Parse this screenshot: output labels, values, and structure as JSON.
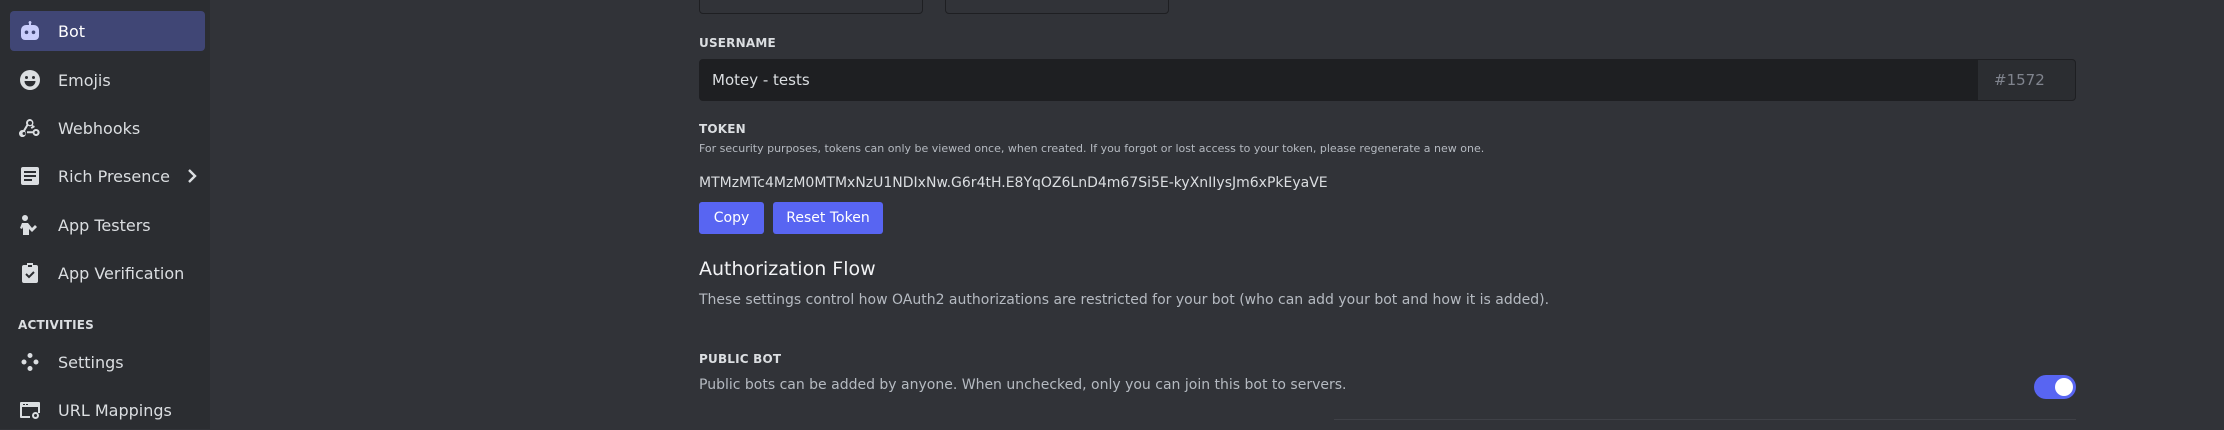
{
  "sidebar": {
    "items": [
      {
        "label": "Bot",
        "icon": "bot-icon",
        "active": true
      },
      {
        "label": "Emojis",
        "icon": "emoji-icon"
      },
      {
        "label": "Webhooks",
        "icon": "webhook-icon"
      },
      {
        "label": "Rich Presence",
        "icon": "rich-presence-icon",
        "has_chevron": true
      },
      {
        "label": "App Testers",
        "icon": "app-testers-icon"
      },
      {
        "label": "App Verification",
        "icon": "app-verification-icon"
      }
    ],
    "section_heading": "ACTIVITIES",
    "activity_items": [
      {
        "label": "Settings",
        "icon": "gamepad-icon"
      },
      {
        "label": "URL Mappings",
        "icon": "url-mapping-icon"
      }
    ]
  },
  "username": {
    "label": "USERNAME",
    "value": "Motey - tests",
    "discriminator": "#1572"
  },
  "token": {
    "label": "TOKEN",
    "help": "For security purposes, tokens can only be viewed once, when created. If you forgot or lost access to your token, please regenerate a new one.",
    "value": "MTMzMTc4MzM0MTMxNzU1NDIxNw.G6r4tH.E8YqOZ6LnD4m67Si5E-kyXnIIysJm6xPkEyaVE",
    "copy_label": "Copy",
    "reset_label": "Reset Token"
  },
  "authorization": {
    "heading": "Authorization Flow",
    "description": "These settings control how OAuth2 authorizations are restricted for your bot (who can add your bot and how it is added)."
  },
  "public_bot": {
    "label": "PUBLIC BOT",
    "description": "Public bots can be added by anyone. When unchecked, only you can join this bot to servers.",
    "enabled": true
  },
  "colors": {
    "accent": "#5865f2",
    "active_nav": "#404675",
    "background": "#313338",
    "sidebar": "#2b2d31"
  }
}
